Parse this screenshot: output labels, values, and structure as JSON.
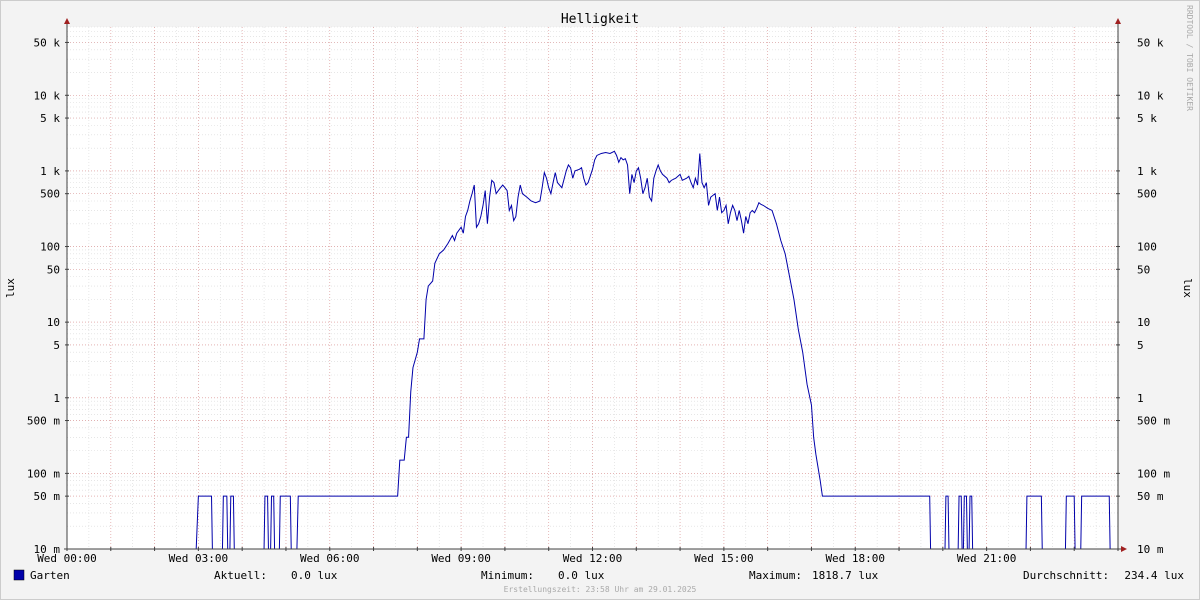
{
  "chart_data": {
    "type": "line",
    "title": "Helligkeit",
    "ylabel": "lux",
    "ylabel_right": "lux",
    "watermark": "RRDTOOL / TOBI OETIKER",
    "y_scale": "log",
    "ylim": [
      0.01,
      80000
    ],
    "y_ticks": [
      {
        "value": 50000,
        "label": "50 k"
      },
      {
        "value": 10000,
        "label": "10 k"
      },
      {
        "value": 5000,
        "label": "5 k"
      },
      {
        "value": 1000,
        "label": "1 k"
      },
      {
        "value": 500,
        "label": "500"
      },
      {
        "value": 100,
        "label": "100"
      },
      {
        "value": 50,
        "label": "50"
      },
      {
        "value": 10,
        "label": "10"
      },
      {
        "value": 5,
        "label": "5"
      },
      {
        "value": 1,
        "label": "1"
      },
      {
        "value": 0.5,
        "label": "500 m"
      },
      {
        "value": 0.1,
        "label": "100 m"
      },
      {
        "value": 0.05,
        "label": "50 m"
      },
      {
        "value": 0.01,
        "label": "10 m"
      }
    ],
    "x_unit": "hours",
    "xlim": [
      0,
      24
    ],
    "x_ticks": [
      {
        "value": 0,
        "label": "Wed 00:00"
      },
      {
        "value": 3,
        "label": "Wed 03:00"
      },
      {
        "value": 6,
        "label": "Wed 06:00"
      },
      {
        "value": 9,
        "label": "Wed 09:00"
      },
      {
        "value": 12,
        "label": "Wed 12:00"
      },
      {
        "value": 15,
        "label": "Wed 15:00"
      },
      {
        "value": 18,
        "label": "Wed 18:00"
      },
      {
        "value": 21,
        "label": "Wed 21:00"
      }
    ],
    "colors": {
      "line": "#0000aa",
      "legend_box": "#0000aa",
      "major_grid": "#e0a0a0",
      "minor_grid": "#d8d8d8",
      "axis": "#404040",
      "arrow": "#a02020",
      "canvas": "#ffffff",
      "background": "#f3f3f3"
    },
    "series": [
      {
        "name": "Garten",
        "points": [
          [
            0.0,
            0.01
          ],
          [
            2.95,
            0.01
          ],
          [
            3.0,
            0.05
          ],
          [
            3.3,
            0.05
          ],
          [
            3.32,
            0.01
          ],
          [
            3.55,
            0.01
          ],
          [
            3.57,
            0.05
          ],
          [
            3.65,
            0.05
          ],
          [
            3.67,
            0.01
          ],
          [
            3.72,
            0.01
          ],
          [
            3.74,
            0.05
          ],
          [
            3.8,
            0.05
          ],
          [
            3.82,
            0.01
          ],
          [
            4.5,
            0.01
          ],
          [
            4.52,
            0.05
          ],
          [
            4.58,
            0.05
          ],
          [
            4.6,
            0.01
          ],
          [
            4.65,
            0.01
          ],
          [
            4.67,
            0.05
          ],
          [
            4.72,
            0.05
          ],
          [
            4.74,
            0.01
          ],
          [
            4.85,
            0.01
          ],
          [
            4.87,
            0.05
          ],
          [
            5.1,
            0.05
          ],
          [
            5.12,
            0.01
          ],
          [
            5.25,
            0.01
          ],
          [
            5.28,
            0.05
          ],
          [
            7.55,
            0.05
          ],
          [
            7.6,
            0.15
          ],
          [
            7.7,
            0.15
          ],
          [
            7.75,
            0.3
          ],
          [
            7.8,
            0.3
          ],
          [
            7.85,
            1.2
          ],
          [
            7.9,
            2.5
          ],
          [
            8.0,
            4
          ],
          [
            8.05,
            6
          ],
          [
            8.15,
            6
          ],
          [
            8.2,
            20
          ],
          [
            8.25,
            30
          ],
          [
            8.35,
            35
          ],
          [
            8.4,
            60
          ],
          [
            8.5,
            80
          ],
          [
            8.6,
            90
          ],
          [
            8.7,
            110
          ],
          [
            8.8,
            140
          ],
          [
            8.85,
            120
          ],
          [
            8.9,
            150
          ],
          [
            9.0,
            180
          ],
          [
            9.05,
            150
          ],
          [
            9.1,
            250
          ],
          [
            9.15,
            300
          ],
          [
            9.2,
            400
          ],
          [
            9.25,
            500
          ],
          [
            9.3,
            650
          ],
          [
            9.35,
            180
          ],
          [
            9.4,
            200
          ],
          [
            9.45,
            250
          ],
          [
            9.5,
            350
          ],
          [
            9.55,
            550
          ],
          [
            9.6,
            200
          ],
          [
            9.65,
            450
          ],
          [
            9.7,
            750
          ],
          [
            9.75,
            700
          ],
          [
            9.8,
            500
          ],
          [
            9.85,
            550
          ],
          [
            9.9,
            600
          ],
          [
            9.95,
            650
          ],
          [
            10.0,
            600
          ],
          [
            10.05,
            550
          ],
          [
            10.1,
            300
          ],
          [
            10.15,
            350
          ],
          [
            10.2,
            220
          ],
          [
            10.25,
            250
          ],
          [
            10.3,
            450
          ],
          [
            10.35,
            650
          ],
          [
            10.4,
            500
          ],
          [
            10.5,
            450
          ],
          [
            10.6,
            400
          ],
          [
            10.7,
            380
          ],
          [
            10.8,
            400
          ],
          [
            10.85,
            600
          ],
          [
            10.9,
            950
          ],
          [
            10.95,
            800
          ],
          [
            11.0,
            600
          ],
          [
            11.05,
            500
          ],
          [
            11.1,
            700
          ],
          [
            11.15,
            950
          ],
          [
            11.2,
            700
          ],
          [
            11.3,
            600
          ],
          [
            11.4,
            1000
          ],
          [
            11.45,
            1200
          ],
          [
            11.5,
            1100
          ],
          [
            11.55,
            800
          ],
          [
            11.6,
            1000
          ],
          [
            11.7,
            1050
          ],
          [
            11.75,
            1100
          ],
          [
            11.8,
            800
          ],
          [
            11.85,
            650
          ],
          [
            11.9,
            700
          ],
          [
            12.0,
            1050
          ],
          [
            12.05,
            1400
          ],
          [
            12.1,
            1600
          ],
          [
            12.2,
            1700
          ],
          [
            12.3,
            1750
          ],
          [
            12.4,
            1700
          ],
          [
            12.5,
            1818.7
          ],
          [
            12.55,
            1600
          ],
          [
            12.6,
            1300
          ],
          [
            12.65,
            1500
          ],
          [
            12.7,
            1400
          ],
          [
            12.75,
            1450
          ],
          [
            12.8,
            1200
          ],
          [
            12.85,
            500
          ],
          [
            12.9,
            900
          ],
          [
            12.95,
            700
          ],
          [
            13.0,
            1000
          ],
          [
            13.05,
            1100
          ],
          [
            13.1,
            800
          ],
          [
            13.15,
            500
          ],
          [
            13.2,
            600
          ],
          [
            13.25,
            800
          ],
          [
            13.3,
            450
          ],
          [
            13.35,
            400
          ],
          [
            13.4,
            800
          ],
          [
            13.45,
            1000
          ],
          [
            13.5,
            1200
          ],
          [
            13.55,
            1000
          ],
          [
            13.6,
            900
          ],
          [
            13.7,
            800
          ],
          [
            13.75,
            700
          ],
          [
            13.8,
            750
          ],
          [
            13.9,
            800
          ],
          [
            14.0,
            900
          ],
          [
            14.05,
            750
          ],
          [
            14.15,
            800
          ],
          [
            14.2,
            850
          ],
          [
            14.25,
            700
          ],
          [
            14.3,
            600
          ],
          [
            14.35,
            800
          ],
          [
            14.4,
            650
          ],
          [
            14.45,
            1700
          ],
          [
            14.5,
            700
          ],
          [
            14.55,
            600
          ],
          [
            14.6,
            700
          ],
          [
            14.65,
            350
          ],
          [
            14.7,
            450
          ],
          [
            14.8,
            500
          ],
          [
            14.85,
            300
          ],
          [
            14.9,
            450
          ],
          [
            14.95,
            280
          ],
          [
            15.0,
            300
          ],
          [
            15.05,
            350
          ],
          [
            15.1,
            200
          ],
          [
            15.15,
            280
          ],
          [
            15.2,
            350
          ],
          [
            15.25,
            300
          ],
          [
            15.3,
            220
          ],
          [
            15.35,
            300
          ],
          [
            15.4,
            220
          ],
          [
            15.45,
            150
          ],
          [
            15.5,
            250
          ],
          [
            15.55,
            200
          ],
          [
            15.6,
            280
          ],
          [
            15.65,
            300
          ],
          [
            15.7,
            280
          ],
          [
            15.75,
            320
          ],
          [
            15.8,
            380
          ],
          [
            15.85,
            360
          ],
          [
            15.9,
            350
          ],
          [
            16.0,
            320
          ],
          [
            16.1,
            300
          ],
          [
            16.2,
            200
          ],
          [
            16.3,
            120
          ],
          [
            16.4,
            80
          ],
          [
            16.5,
            40
          ],
          [
            16.6,
            20
          ],
          [
            16.7,
            8
          ],
          [
            16.8,
            4
          ],
          [
            16.9,
            1.5
          ],
          [
            17.0,
            0.8
          ],
          [
            17.05,
            0.3
          ],
          [
            17.1,
            0.18
          ],
          [
            17.15,
            0.12
          ],
          [
            17.2,
            0.08
          ],
          [
            17.25,
            0.05
          ],
          [
            19.7,
            0.05
          ],
          [
            19.72,
            0.01
          ],
          [
            20.05,
            0.01
          ],
          [
            20.07,
            0.05
          ],
          [
            20.12,
            0.05
          ],
          [
            20.14,
            0.01
          ],
          [
            20.35,
            0.01
          ],
          [
            20.37,
            0.05
          ],
          [
            20.42,
            0.05
          ],
          [
            20.44,
            0.01
          ],
          [
            20.47,
            0.01
          ],
          [
            20.49,
            0.05
          ],
          [
            20.54,
            0.05
          ],
          [
            20.56,
            0.01
          ],
          [
            20.6,
            0.01
          ],
          [
            20.62,
            0.05
          ],
          [
            20.66,
            0.05
          ],
          [
            20.68,
            0.01
          ],
          [
            21.9,
            0.01
          ],
          [
            21.92,
            0.05
          ],
          [
            22.25,
            0.05
          ],
          [
            22.27,
            0.01
          ],
          [
            22.8,
            0.01
          ],
          [
            22.82,
            0.05
          ],
          [
            23.0,
            0.05
          ],
          [
            23.02,
            0.01
          ],
          [
            23.15,
            0.01
          ],
          [
            23.17,
            0.05
          ],
          [
            23.8,
            0.05
          ],
          [
            23.82,
            0.01
          ],
          [
            24.0,
            0.01
          ]
        ]
      }
    ]
  },
  "legend": {
    "name": "Garten",
    "aktuell_label": "Aktuell:",
    "aktuell_value": "0.0 lux",
    "minimum_label": "Minimum:",
    "minimum_value": "0.0 lux",
    "maximum_label": "Maximum:",
    "maximum_value": "1818.7 lux",
    "avg_label": "Durchschnitt:",
    "avg_value": "234.4 lux"
  },
  "footer": "Erstellungszeit: 23:58 Uhr am 29.01.2025"
}
